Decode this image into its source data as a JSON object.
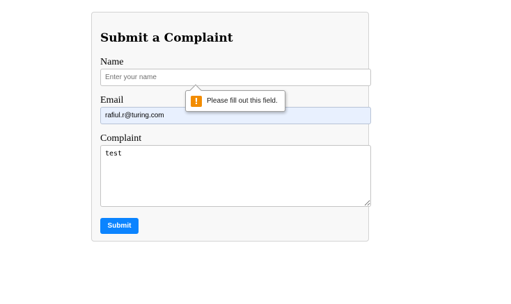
{
  "form": {
    "title": "Submit a Complaint",
    "name_label": "Name",
    "name_placeholder": "Enter your name",
    "name_value": "",
    "email_label": "Email",
    "email_value": "rafiul.r@turing.com",
    "complaint_label": "Complaint",
    "complaint_value": "test",
    "submit_label": "Submit"
  },
  "validation": {
    "message": "Please fill out this field.",
    "icon": "warning-icon",
    "icon_glyph": "!"
  },
  "colors": {
    "primary": "#0b84ff",
    "warning": "#f28c00",
    "autofill_background": "#e8f0fe",
    "card_background": "#f8f8f8"
  }
}
